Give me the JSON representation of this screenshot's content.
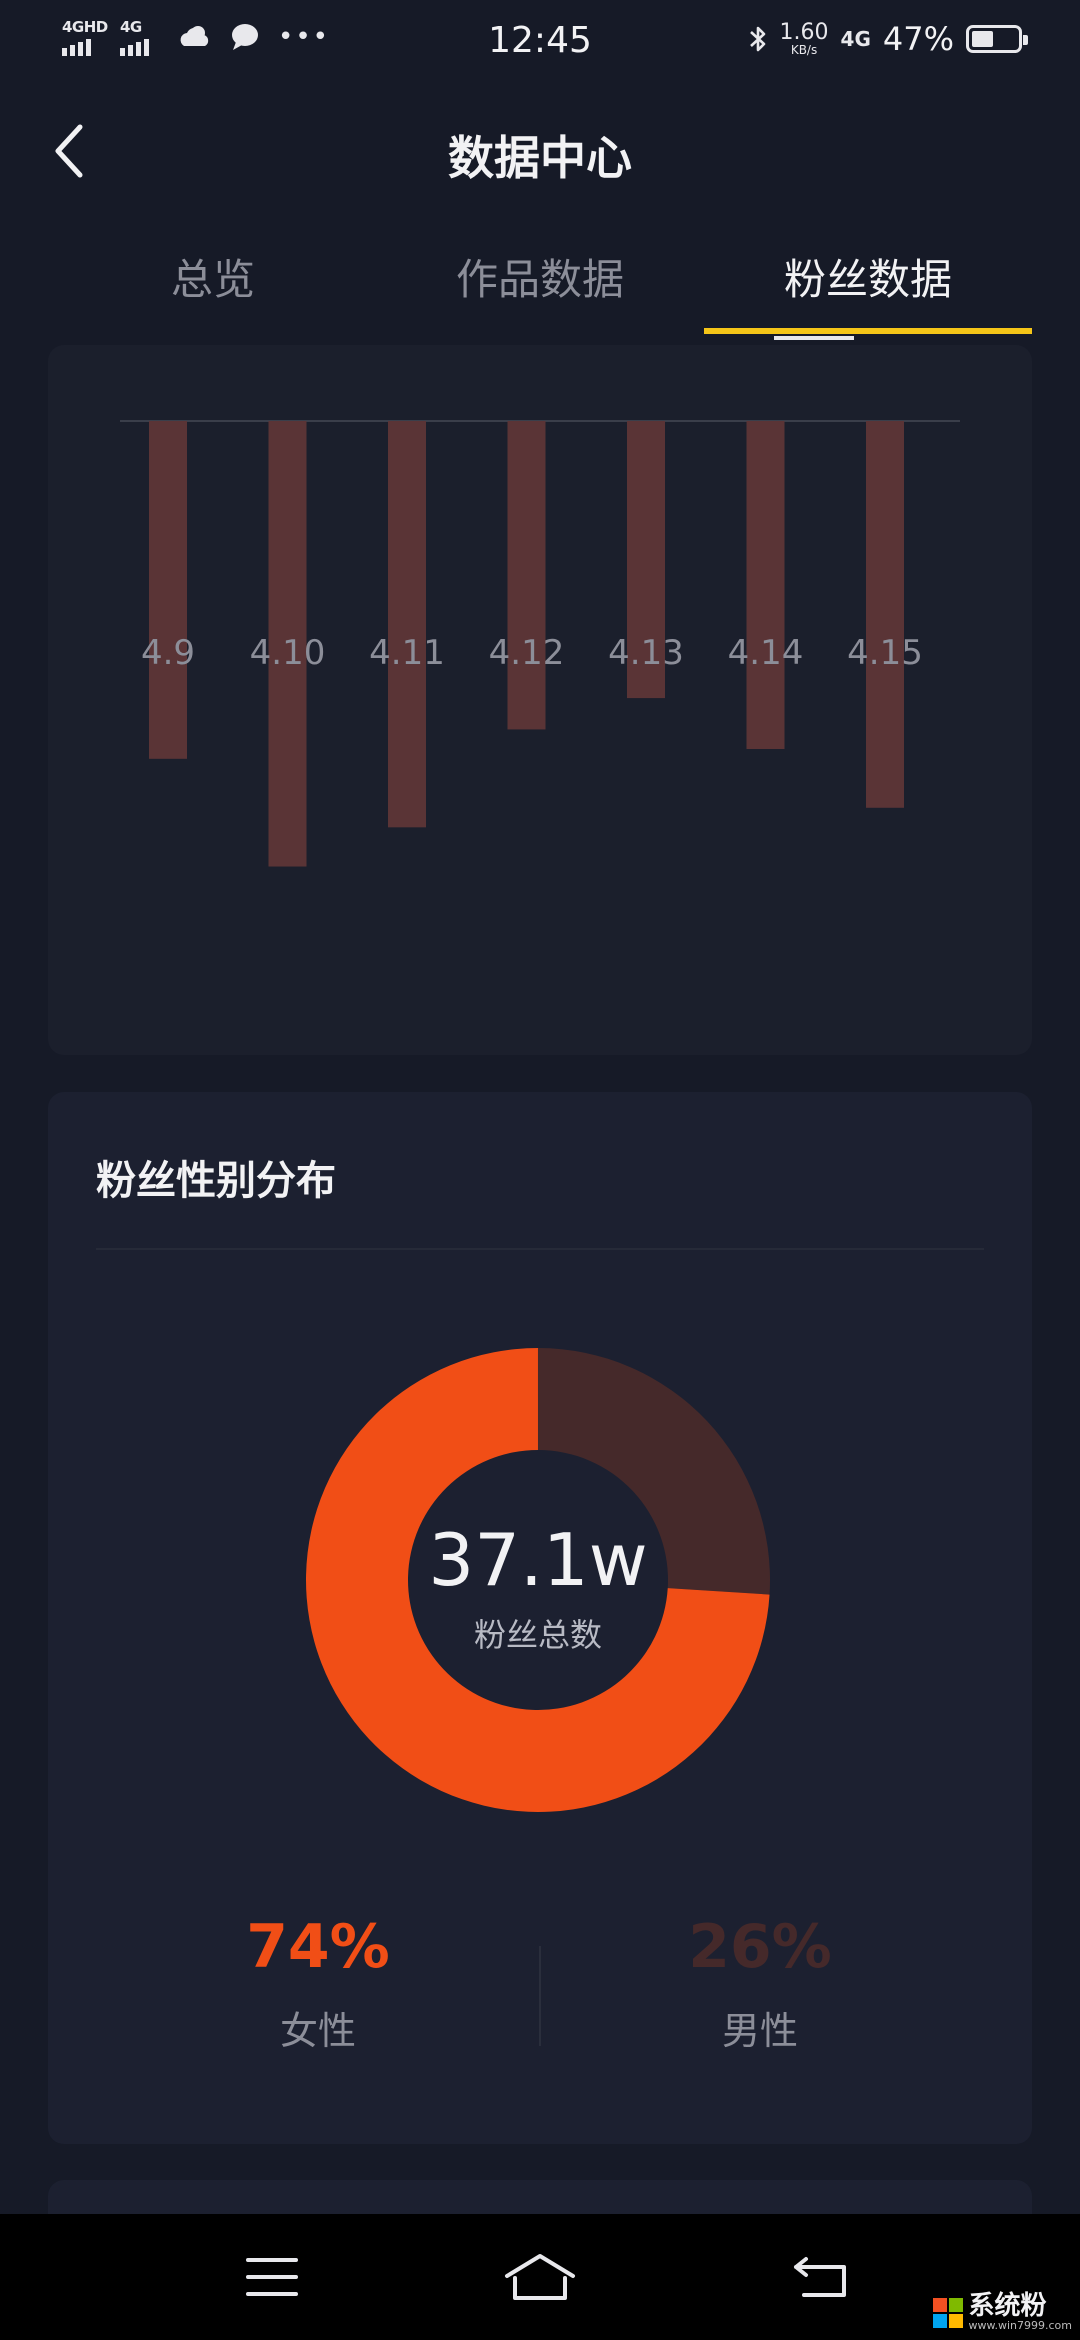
{
  "status_bar": {
    "signal1_label": "4GHD",
    "signal2_label": "4G",
    "time": "12:45",
    "speed_value": "1.60",
    "speed_unit": "KB/s",
    "network": "4G",
    "battery": "47%",
    "battery_level": 0.47
  },
  "header": {
    "title": "数据中心"
  },
  "tabs": [
    {
      "label": "总览",
      "active": false
    },
    {
      "label": "作品数据",
      "active": false
    },
    {
      "label": "粉丝数据",
      "active": true
    }
  ],
  "chart_data": {
    "type": "bar",
    "categories": [
      "4.9",
      "4.10",
      "4.11",
      "4.12",
      "4.13",
      "4.14",
      "4.15"
    ],
    "values": [
      -345,
      -455,
      -415,
      -315,
      -283,
      -335,
      -395
    ],
    "ylim": [
      -480,
      0
    ],
    "grid": false,
    "color": "#5a3436",
    "baseline_color": "#3a3e4a"
  },
  "gender": {
    "title": "粉丝性别分布",
    "total_value": "37.1w",
    "total_label": "粉丝总数",
    "female_pct": "74%",
    "female_label": "女性",
    "male_pct": "26%",
    "male_label": "男性",
    "female_fraction": 0.74,
    "male_fraction": 0.26,
    "female_color": "#f14e16",
    "male_color": "#45292a"
  },
  "watermark": {
    "brand": "系统粉",
    "url": "www.win7999.com"
  }
}
